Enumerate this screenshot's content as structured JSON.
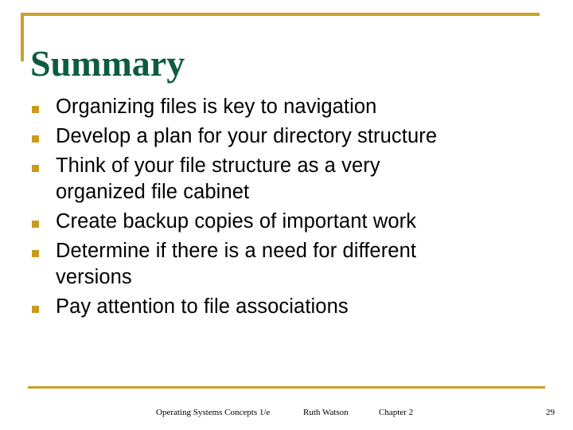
{
  "slide": {
    "title": "Summary",
    "accent_color": "#c9a227",
    "title_color": "#0d5c3f",
    "bullet_color": "#cb9a1e",
    "text_color": "#000000",
    "background_color": "#ffffff"
  },
  "bullets": [
    {
      "marker": "square-bullet",
      "text": "Organizing files is key to navigation",
      "lines": [
        "Organizing files is key to navigation"
      ]
    },
    {
      "marker": "square-bullet",
      "text": "Develop a plan for your directory structure",
      "lines": [
        "Develop a plan for your directory structure"
      ]
    },
    {
      "marker": "square-bullet",
      "text": "Think of your file structure as a very organized file cabinet",
      "lines": [
        "Think of your file structure as a very",
        "organized file cabinet"
      ]
    },
    {
      "marker": "square-bullet",
      "text": "Create backup copies of important work",
      "lines": [
        "Create backup copies of important work"
      ]
    },
    {
      "marker": "square-bullet",
      "text": "Determine if there is a need for different versions",
      "lines": [
        "Determine if there is a need for different",
        "versions"
      ]
    },
    {
      "marker": "square-bullet",
      "text": "Pay attention to file associations",
      "lines": [
        "Pay attention to file associations"
      ]
    }
  ],
  "footer": {
    "course": "Operating Systems Concepts 1/e",
    "author": "Ruth Watson",
    "chapter": "Chapter 2",
    "page_number": "29"
  }
}
